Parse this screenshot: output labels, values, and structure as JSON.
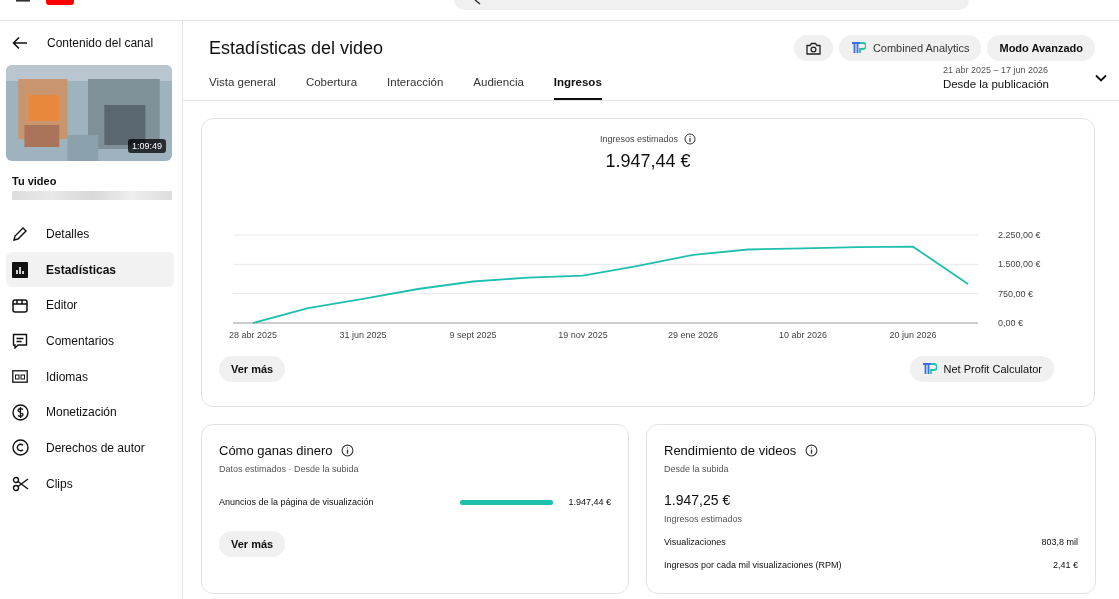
{
  "sidebar": {
    "back_label": "Contenido del canal",
    "thumbnail": {
      "kind": "picture",
      "duration": "1:09:49"
    },
    "video_label": "Tu video",
    "items": [
      {
        "label": "Detalles",
        "selected": false
      },
      {
        "label": "Estadísticas",
        "selected": true
      },
      {
        "label": "Editor",
        "selected": false
      },
      {
        "label": "Comentarios",
        "selected": false
      },
      {
        "label": "Idiomas",
        "selected": false
      },
      {
        "label": "Monetización",
        "selected": false
      },
      {
        "label": "Derechos de autor",
        "selected": false
      },
      {
        "label": "Clips",
        "selected": false
      }
    ]
  },
  "header": {
    "title": "Estadísticas del video",
    "buttons": [
      "Combined Analytics",
      "Modo Avanzado"
    ]
  },
  "tabs": [
    {
      "label": "Vista general",
      "selected": false
    },
    {
      "label": "Cobertura",
      "selected": false
    },
    {
      "label": "Interacción",
      "selected": false
    },
    {
      "label": "Audiencia",
      "selected": false
    },
    {
      "label": "Ingresos",
      "selected": true
    }
  ],
  "date_range": {
    "range": "21 abr 2025 – 17 jun 2026",
    "label": "Desde la publicación"
  },
  "revenue_card": {
    "metric_label": "Ingresos estimados",
    "metric_value": "1.947,44 €",
    "chart_data": {
      "type": "line",
      "categories": [
        "28 abr 2025",
        null,
        "31 jun 2025",
        null,
        "9 sept 2025",
        null,
        "19 nov 2025",
        null,
        "29 ene 2026",
        null,
        "10 abr 2026",
        null,
        "20 jun 2026",
        null
      ],
      "series": [
        {
          "color": "#1fbfae",
          "values": [
            0,
            380,
            620,
            870,
            1060,
            1160,
            1210,
            1460,
            1740,
            1880,
            1910,
            1940,
            1950,
            1000
          ]
        }
      ],
      "ylim": [
        0,
        2250
      ],
      "yticks": [
        {
          "value": 0,
          "label": "0,00 €"
        },
        {
          "value": 750,
          "label": "750,00 €"
        },
        {
          "value": 1500,
          "label": "1.500,00 €"
        },
        {
          "value": 2250,
          "label": "2.250,00 €"
        }
      ]
    },
    "more_button": "Ver más",
    "calculator_button": "Net Profit Calculator"
  },
  "earn_card": {
    "title": "Cómo ganas dinero",
    "subtitle": "Datos estimados · Desde la subida",
    "rows": [
      {
        "label": "Anuncios de la página de visualización",
        "level": 1,
        "value": "1.947,44 €"
      }
    ],
    "more_button": "Ver más"
  },
  "performance_card": {
    "title": "Rendimiento de videos",
    "subtitle": "Desde la subida",
    "total": "1.947,25 €",
    "total_label": "Ingresos estimados",
    "rows": [
      {
        "label": "Visualizaciones",
        "value": "803,8 mil"
      },
      {
        "label": "Ingresos por cada mil visualizaciones (RPM)",
        "value": "2,41 €"
      }
    ]
  }
}
